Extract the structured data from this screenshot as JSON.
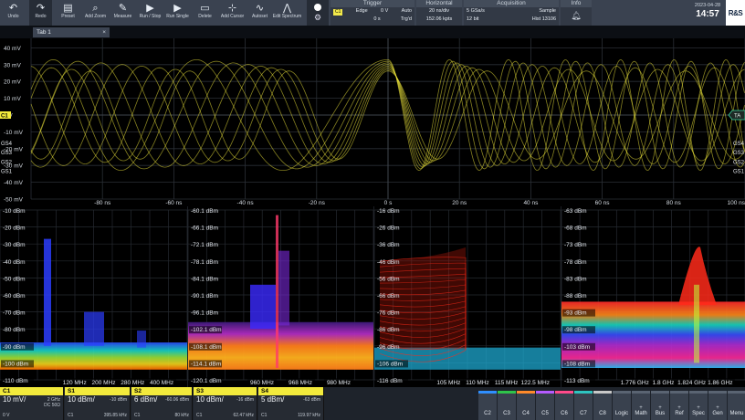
{
  "toolbar": {
    "buttons": [
      {
        "label": "Undo",
        "icon": "undo-icon",
        "glyph": "↶"
      },
      {
        "label": "Redo",
        "icon": "redo-icon",
        "glyph": "↷"
      },
      {
        "label": "Preset",
        "icon": "preset-icon",
        "glyph": "▤"
      },
      {
        "label": "Add Zoom",
        "icon": "zoom-icon",
        "glyph": "⌕"
      },
      {
        "label": "Measure",
        "icon": "measure-icon",
        "glyph": "✎"
      },
      {
        "label": "Run / Stop",
        "icon": "run-stop-icon",
        "glyph": "▶"
      },
      {
        "label": "Run Single",
        "icon": "run-single-icon",
        "glyph": "▶"
      },
      {
        "label": "Delete",
        "icon": "delete-icon",
        "glyph": "▭"
      },
      {
        "label": "Add Cursor",
        "icon": "cursor-icon",
        "glyph": "⊹"
      },
      {
        "label": "Autoset",
        "icon": "autoset-icon",
        "glyph": "∿"
      },
      {
        "label": "Edit Spectrum",
        "icon": "spectrum-icon",
        "glyph": "⋀"
      }
    ],
    "trigger": {
      "header": "Trigger",
      "source": "C1",
      "type": "Edge",
      "level": "0 V",
      "mode": "Auto",
      "coupling": "Trg'd",
      "delay": "0 s"
    },
    "horizontal": {
      "header": "Horizontal",
      "scale": "20 ns/div",
      "length": "152.06 kpts"
    },
    "acquisition": {
      "header": "Acquisition",
      "rate": "5 GSa/s",
      "mode": "Sample",
      "bits": "12 bit",
      "hist": "Hist 13106"
    },
    "info": {
      "header": "Info"
    },
    "date": "2023-04-28",
    "time": "14:57",
    "logo": "R&S"
  },
  "tab": {
    "label": "Tab 1"
  },
  "scope": {
    "y_labels": [
      "50 mV",
      "40 mV",
      "30 mV",
      "20 mV",
      "10 mV",
      "0 V",
      "-10 mV",
      "-20 mV",
      "-30 mV",
      "-40 mV",
      "-50 mV"
    ],
    "x_labels": [
      "-80 ns",
      "-60 ns",
      "-40 ns",
      "-20 ns",
      "0 s",
      "20 ns",
      "40 ns",
      "60 ns",
      "80 ns",
      "100 ns"
    ],
    "left_markers": [
      "C1",
      "GS4",
      "GS3",
      "GS2",
      "GS1"
    ],
    "right_markers": [
      "GS4",
      "GS3",
      "GS2",
      "GS1"
    ],
    "trigger_marker": "TA",
    "trace_color": "#f2ea3c"
  },
  "spectra": [
    {
      "y_labels": [
        "-10 dBm",
        "-20 dBm",
        "-30 dBm",
        "-40 dBm",
        "-50 dBm",
        "-60 dBm",
        "-70 dBm",
        "-80 dBm",
        "-90 dBm",
        "-100 dBm",
        "-110 dBm"
      ],
      "x_labels": [
        "120 MHz",
        "200 MHz",
        "280 MHz",
        "400 MHz"
      ]
    },
    {
      "y_labels": [
        "-60.1 dBm",
        "-66.1 dBm",
        "-72.1 dBm",
        "-78.1 dBm",
        "-84.1 dBm",
        "-90.1 dBm",
        "-96.1 dBm",
        "-102.1 dBm",
        "-108.1 dBm",
        "-114.1 dBm",
        "-120.1 dBm"
      ],
      "x_labels": [
        "960 MHz",
        "968 MHz",
        "980 MHz"
      ]
    },
    {
      "y_labels": [
        "-16 dBm",
        "-26 dBm",
        "-36 dBm",
        "-46 dBm",
        "-56 dBm",
        "-66 dBm",
        "-76 dBm",
        "-86 dBm",
        "-96 dBm",
        "-106 dBm",
        "-116 dBm"
      ],
      "x_labels": [
        "105 MHz",
        "110 MHz",
        "115 MHz",
        "122.5 MHz"
      ]
    },
    {
      "y_labels": [
        "-63 dBm",
        "-68 dBm",
        "-73 dBm",
        "-78 dBm",
        "-83 dBm",
        "-88 dBm",
        "-93 dBm",
        "-98 dBm",
        "-103 dBm",
        "-108 dBm",
        "-113 dBm"
      ],
      "x_labels": [
        "1.776 GHz",
        "1.8 GHz",
        "1.824 GHz",
        "1.86 GHz"
      ]
    }
  ],
  "channels": [
    {
      "name": "C1",
      "color": "#f2ea3c",
      "scale": "10 mV/",
      "sub1": "2 GHz",
      "sub2": "DC 50Ω",
      "foot": "0 V"
    },
    {
      "name": "S1",
      "color": "#f2ea3c",
      "scale": "10 dBm/",
      "sub1": "-10 dBm",
      "sub2": "",
      "foot": "C1",
      "right": "395.85 kHz"
    },
    {
      "name": "S2",
      "color": "#f2ea3c",
      "scale": "6 dBm/",
      "sub1": "-60.06 dBm",
      "sub2": "",
      "foot": "C1",
      "right": "80 kHz"
    },
    {
      "name": "S3",
      "color": "#f2ea3c",
      "scale": "10 dBm/",
      "sub1": "-16 dBm",
      "sub2": "",
      "foot": "C1",
      "right": "62.47 kHz"
    },
    {
      "name": "S4",
      "color": "#f2ea3c",
      "scale": "5 dBm/",
      "sub1": "-63 dBm",
      "sub2": "",
      "foot": "C1",
      "right": "119.97 kHz"
    }
  ],
  "right_buttons": [
    {
      "label": "C2",
      "color": "#7a8594"
    },
    {
      "label": "C3",
      "color": "#7a8594"
    },
    {
      "label": "C4",
      "color": "#7a8594"
    },
    {
      "label": "C5",
      "color": "#7a8594"
    },
    {
      "label": "C6",
      "color": "#7a8594"
    },
    {
      "label": "C7",
      "color": "#7a8594"
    },
    {
      "label": "C8",
      "color": "#7a8594"
    },
    {
      "label": "Logic",
      "color": "#7a8594"
    },
    {
      "label": "Math",
      "color": "#7a8594"
    },
    {
      "label": "Bus",
      "color": "#7a8594"
    },
    {
      "label": "Ref",
      "color": "#7a8594"
    },
    {
      "label": "Spec",
      "color": "#7a8594"
    },
    {
      "label": "Gen",
      "color": "#7a8594"
    },
    {
      "label": "Menu",
      "color": "#7a8594"
    }
  ]
}
